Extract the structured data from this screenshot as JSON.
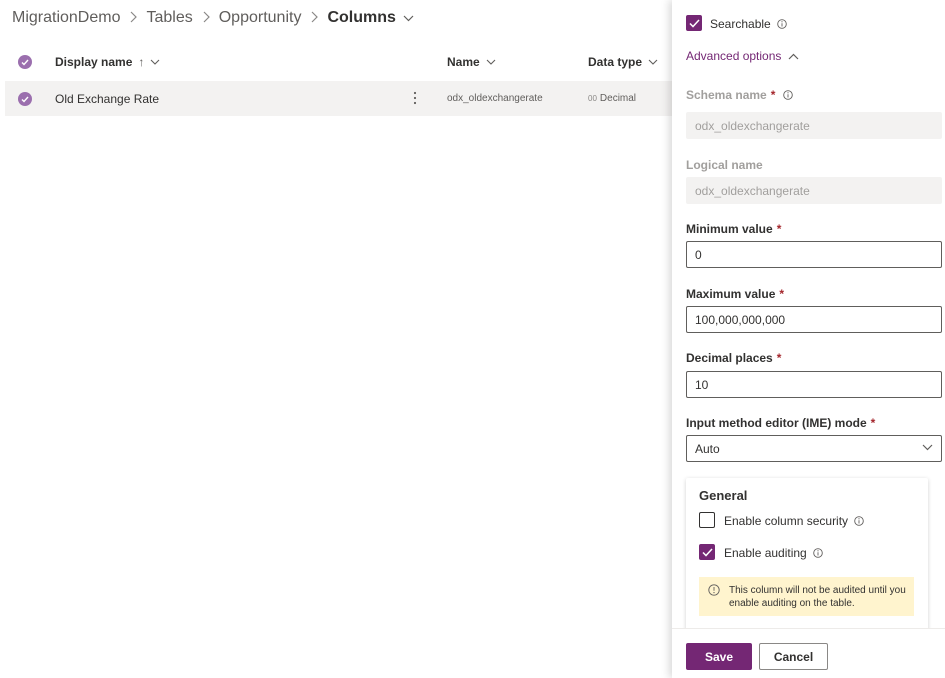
{
  "breadcrumb": {
    "items": [
      "MigrationDemo",
      "Tables",
      "Opportunity"
    ],
    "current": "Columns"
  },
  "grid": {
    "columns": {
      "display_name": "Display name",
      "sort_arrow": "↑",
      "name": "Name",
      "data_type": "Data type"
    },
    "rows": [
      {
        "display_name": "Old Exchange Rate",
        "name": "odx_oldexchangerate",
        "type_prefix": "00",
        "data_type": "Decimal"
      }
    ]
  },
  "panel": {
    "searchable_label": "Searchable",
    "advanced_options_label": "Advanced options",
    "schema_name": {
      "label": "Schema name",
      "required": "*",
      "value": "odx_oldexchangerate"
    },
    "logical_name": {
      "label": "Logical name",
      "value": "odx_oldexchangerate"
    },
    "minimum_value": {
      "label": "Minimum value",
      "required": "*",
      "value": "0"
    },
    "maximum_value": {
      "label": "Maximum value",
      "required": "*",
      "value": "100,000,000,000"
    },
    "decimal_places": {
      "label": "Decimal places",
      "required": "*",
      "value": "10"
    },
    "ime_mode": {
      "label": "Input method editor (IME) mode",
      "required": "*",
      "value": "Auto"
    },
    "general": {
      "title": "General",
      "column_security_label": "Enable column security",
      "auditing_label": "Enable auditing",
      "notice": "This column will not be audited until you enable auditing on the table."
    },
    "save_label": "Save",
    "cancel_label": "Cancel"
  },
  "colors": {
    "accent": "#742774",
    "row_check": "#9b6fae",
    "notice_bg": "#fff4ce"
  },
  "state": {
    "searchable_checked": true,
    "column_security_checked": false,
    "auditing_checked": true
  }
}
